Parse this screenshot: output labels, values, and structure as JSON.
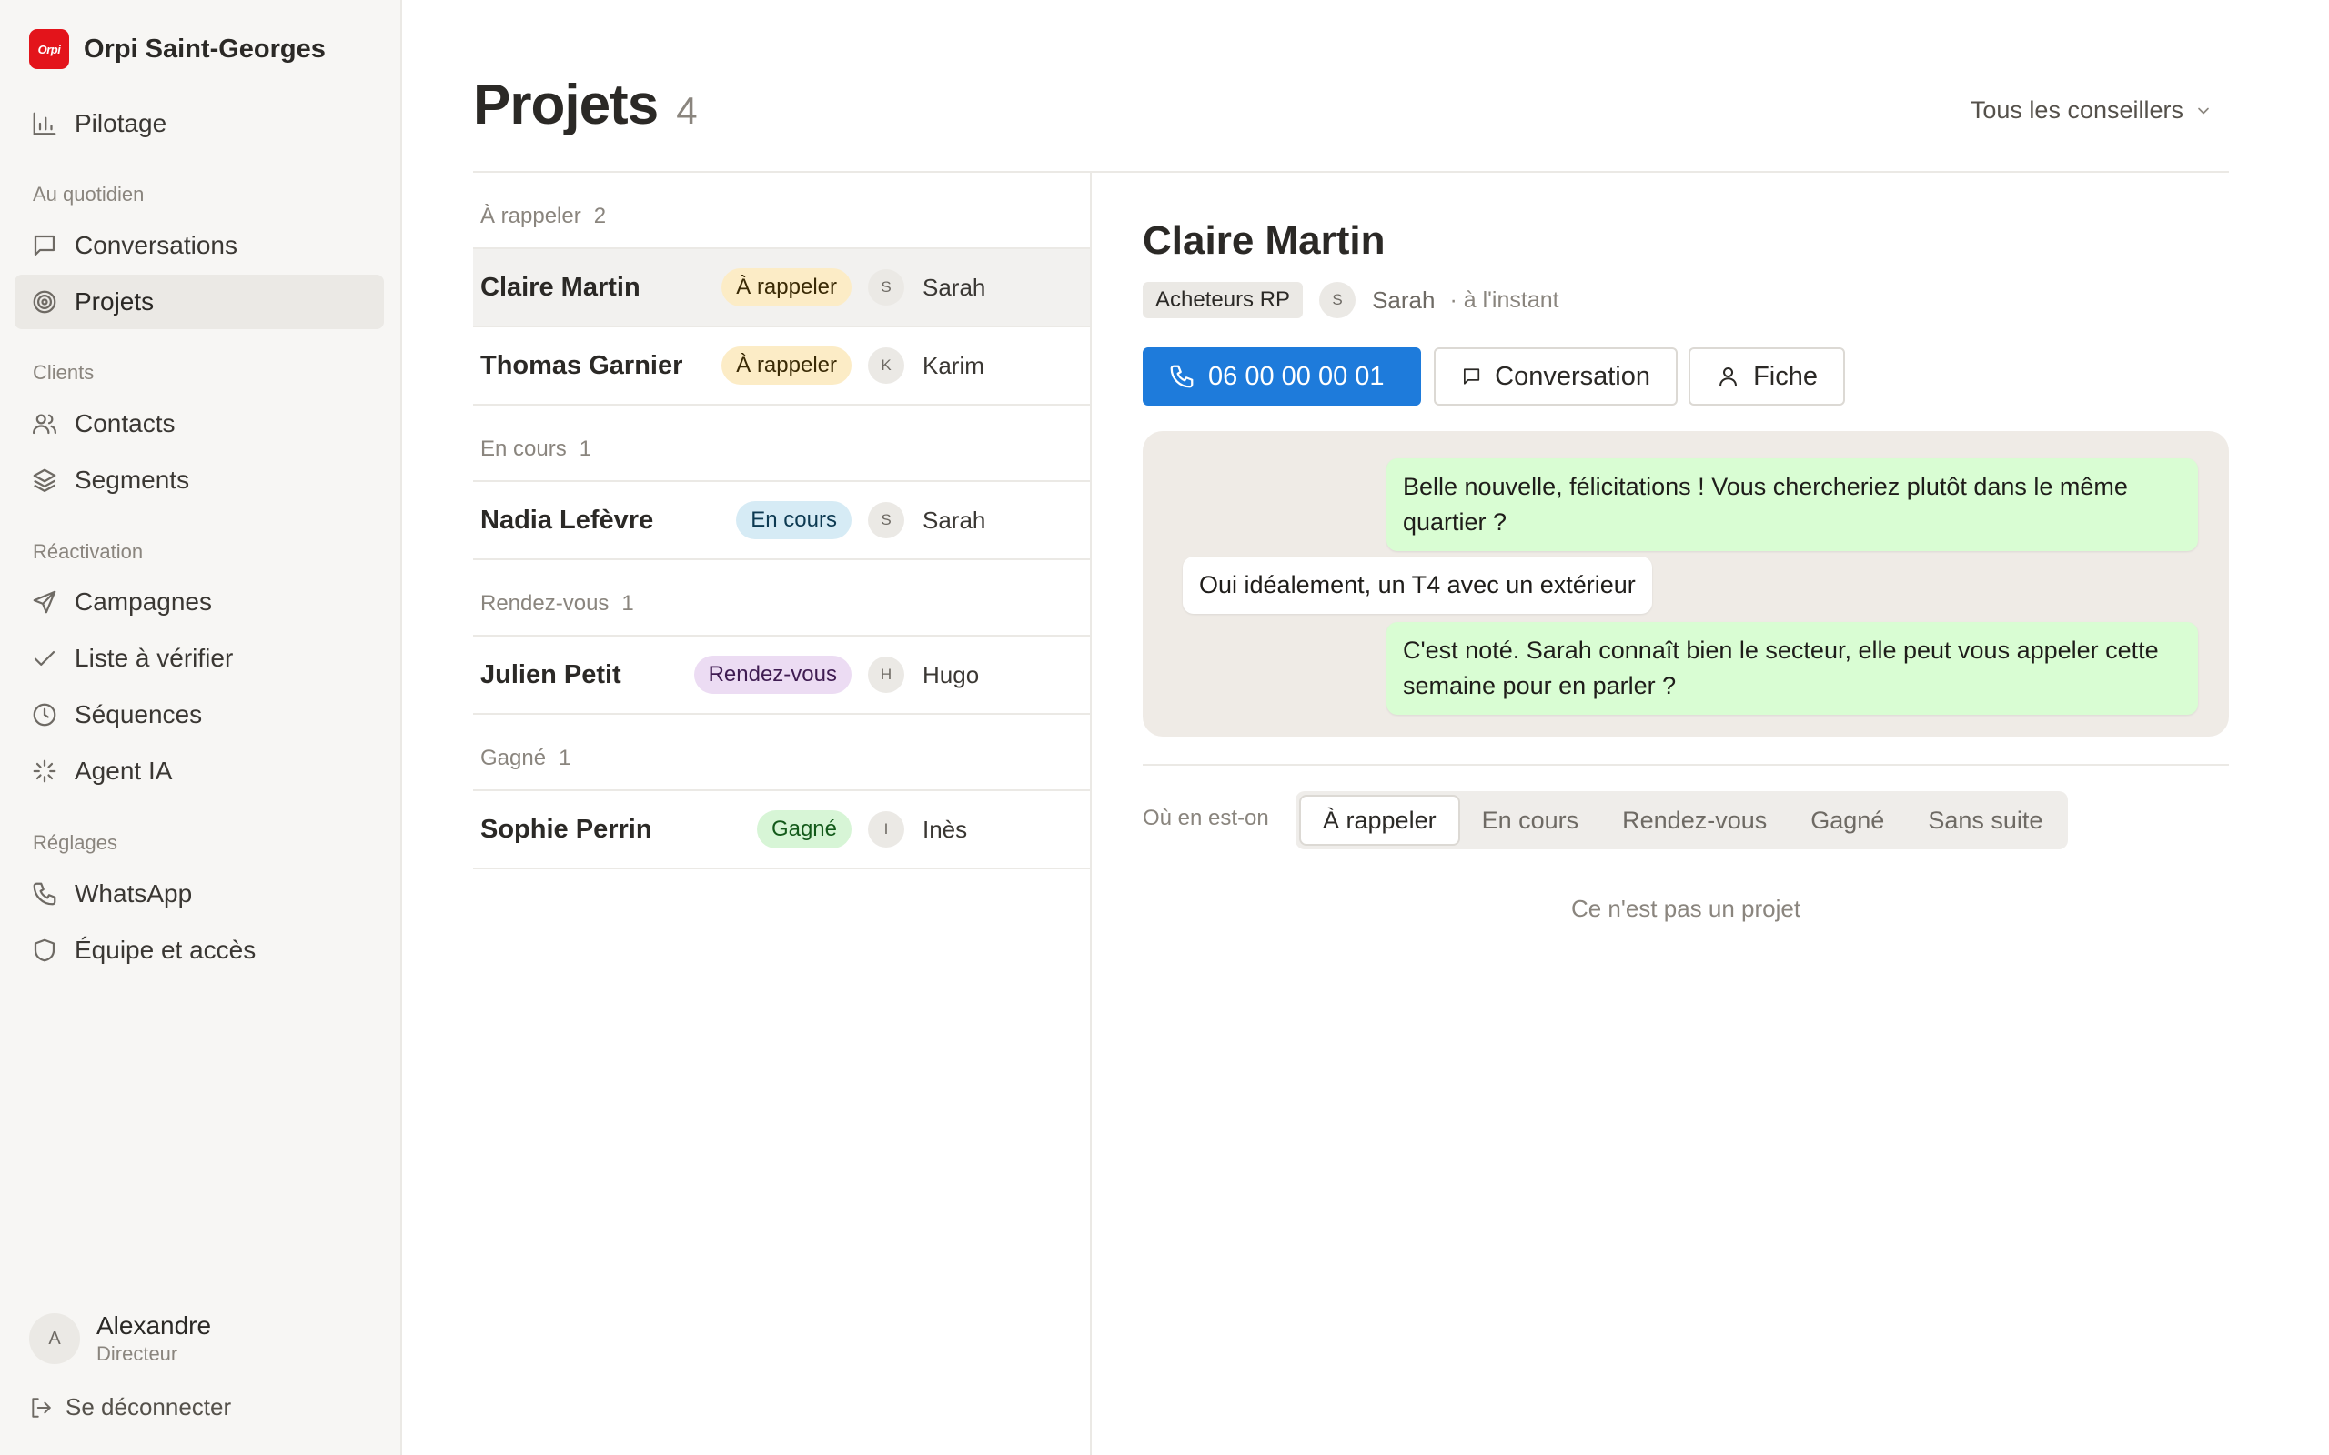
{
  "brand": {
    "logo_text": "Orpi",
    "name": "Orpi Saint-Georges",
    "color": "#e3141b"
  },
  "sidebar": {
    "top_item": {
      "label": "Pilotage",
      "icon": "bar-chart-icon"
    },
    "sections": [
      {
        "title": "Au quotidien",
        "items": [
          {
            "label": "Conversations",
            "icon": "message-square-icon"
          },
          {
            "label": "Projets",
            "icon": "target-icon",
            "active": true
          }
        ]
      },
      {
        "title": "Clients",
        "items": [
          {
            "label": "Contacts",
            "icon": "users-icon"
          },
          {
            "label": "Segments",
            "icon": "layers-icon"
          }
        ]
      },
      {
        "title": "Réactivation",
        "items": [
          {
            "label": "Campagnes",
            "icon": "send-icon"
          },
          {
            "label": "Liste à vérifier",
            "icon": "check-icon"
          },
          {
            "label": "Séquences",
            "icon": "clock-icon"
          },
          {
            "label": "Agent IA",
            "icon": "sparkle-icon"
          }
        ]
      },
      {
        "title": "Réglages",
        "items": [
          {
            "label": "WhatsApp",
            "icon": "phone-icon"
          },
          {
            "label": "Équipe et accès",
            "icon": "shield-icon"
          }
        ]
      }
    ],
    "user": {
      "initial": "A",
      "name": "Alexandre",
      "role": "Directeur"
    },
    "logout_label": "Se déconnecter"
  },
  "header": {
    "title": "Projets",
    "count": "4",
    "filter_label": "Tous les conseillers"
  },
  "groups": [
    {
      "label": "À rappeler",
      "count": "2",
      "rows": [
        {
          "name": "Claire Martin",
          "status": "À rappeler",
          "owner_initial": "S",
          "owner": "Sarah",
          "selected": true
        },
        {
          "name": "Thomas Garnier",
          "status": "À rappeler",
          "owner_initial": "K",
          "owner": "Karim"
        }
      ]
    },
    {
      "label": "En cours",
      "count": "1",
      "rows": [
        {
          "name": "Nadia Lefèvre",
          "status": "En cours",
          "owner_initial": "S",
          "owner": "Sarah"
        }
      ]
    },
    {
      "label": "Rendez-vous",
      "count": "1",
      "rows": [
        {
          "name": "Julien Petit",
          "status": "Rendez-vous",
          "owner_initial": "H",
          "owner": "Hugo"
        }
      ]
    },
    {
      "label": "Gagné",
      "count": "1",
      "rows": [
        {
          "name": "Sophie Perrin",
          "status": "Gagné",
          "owner_initial": "I",
          "owner": "Inès"
        }
      ]
    }
  ],
  "status_colors": {
    "À rappeler": {
      "bg": "#fcecc6",
      "fg": "#3a2a05"
    },
    "En cours": {
      "bg": "#d6ebf5",
      "fg": "#0d3a52"
    },
    "Rendez-vous": {
      "bg": "#ecdcf3",
      "fg": "#3f1c52"
    },
    "Gagné": {
      "bg": "#d7f5d6",
      "fg": "#135a1a"
    }
  },
  "detail": {
    "name": "Claire Martin",
    "tag": "Acheteurs RP",
    "owner_initial": "S",
    "owner": "Sarah",
    "time": "· à l'instant",
    "buttons": {
      "phone": "06 00 00 00 01",
      "conversation": "Conversation",
      "fiche": "Fiche"
    },
    "messages": [
      {
        "direction": "out",
        "text": "Belle nouvelle, félicitations ! Vous chercheriez plutôt dans le même quartier ?"
      },
      {
        "direction": "in",
        "text": "Oui idéalement, un T4 avec un extérieur"
      },
      {
        "direction": "out",
        "text": "C'est noté. Sarah connaît bien le secteur, elle peut vous appeler cette semaine pour en parler ?"
      }
    ],
    "status_label": "Où en est-on",
    "status_options": [
      "À rappeler",
      "En cours",
      "Rendez-vous",
      "Gagné",
      "Sans suite"
    ],
    "status_selected": "À rappeler",
    "not_project": "Ce n'est pas un projet"
  }
}
